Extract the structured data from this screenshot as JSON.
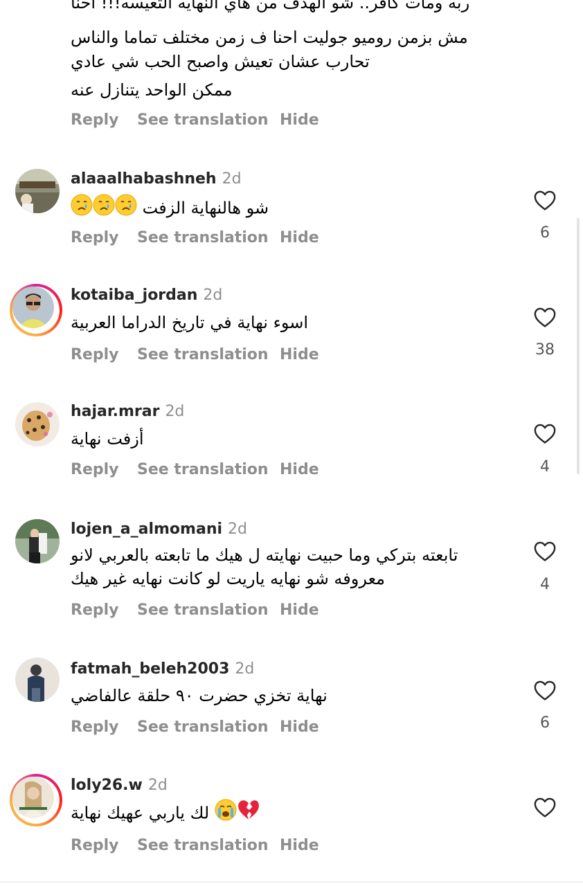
{
  "top_comment": {
    "lines": [
      "ربه ومات كافر.. شو الهدف من هاي النهايه التعيسه!!! احنا",
      "مش بزمن روميو جوليت احنا ف زمن مختلف تماما والناس",
      "تحارب عشان تعيش واصبح الحب شي عادي",
      "ممكن الواحد يتنازل عنه"
    ],
    "actions": {
      "reply": "Reply",
      "translate": "See translation",
      "hide": "Hide"
    }
  },
  "comments": [
    {
      "username": "alaaalhabashneh",
      "time": "2d",
      "text": "شو هالنهاية الزفت",
      "emoji": [
        "crying-face",
        "crying-face",
        "crying-face"
      ],
      "likes": "6",
      "actions": {
        "reply": "Reply",
        "translate": "See translation",
        "hide": "Hide"
      }
    },
    {
      "username": "kotaiba_jordan",
      "time": "2d",
      "text": "اسوء نهاية في تاريخ الدراما العربية",
      "likes": "38",
      "actions": {
        "reply": "Reply",
        "translate": "See translation",
        "hide": "Hide"
      }
    },
    {
      "username": "hajar.mrar",
      "time": "2d",
      "text": "أزفت نهاية",
      "likes": "4",
      "actions": {
        "reply": "Reply",
        "translate": "See translation",
        "hide": "Hide"
      }
    },
    {
      "username": "lojen_a_almomani",
      "time": "2d",
      "text_lines": [
        "تابعته بتركي وما حبيت نهايته ل هيك ما تابعته بالعربي لانو",
        "معروفه شو نهايه ياريت لو كانت نهايه غير هيك"
      ],
      "likes": "4",
      "actions": {
        "reply": "Reply",
        "translate": "See translation",
        "hide": "Hide"
      }
    },
    {
      "username": "fatmah_beleh2003",
      "time": "2d",
      "text": "نهاية تخزي حضرت ٩٠ حلقة عالفاضي",
      "likes": "6",
      "actions": {
        "reply": "Reply",
        "translate": "See translation",
        "hide": "Hide"
      }
    },
    {
      "username": "loly26.w",
      "time": "2d",
      "text": "لك يا‌ربي عهيك نهاية",
      "emoji": [
        "loudly-crying-face",
        "broken-heart"
      ],
      "likes": "",
      "actions": {
        "reply": "Reply",
        "translate": "See translation",
        "hide": "Hide"
      }
    }
  ],
  "colors": {
    "username": "#262626",
    "secondary": "#8e8e8e",
    "story_ring": "#d6249f"
  }
}
